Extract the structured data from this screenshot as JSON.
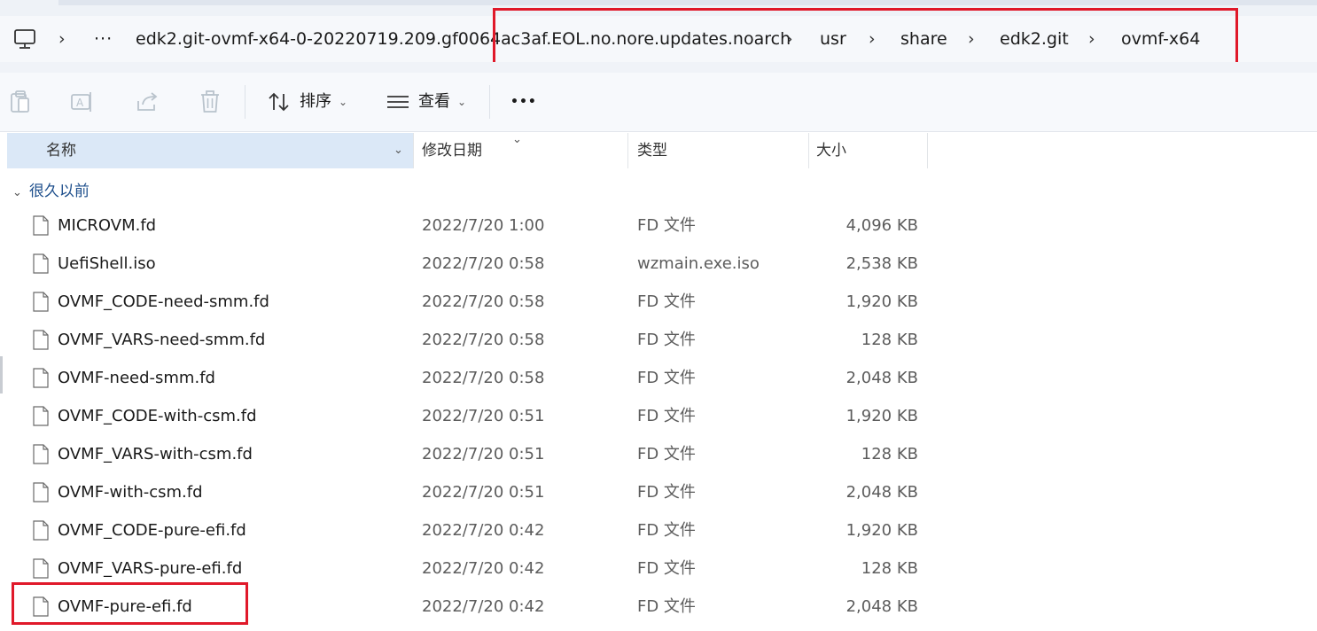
{
  "breadcrumb": {
    "more": "···",
    "segments": [
      "edk2.git-ovmf-x64-0-20220719.209.gf0064ac3af.EOL.no.nore.updates.noarch",
      "usr",
      "share",
      "edk2.git",
      "ovmf-x64"
    ]
  },
  "toolbar": {
    "sort_label": "排序",
    "view_label": "查看",
    "more_label": "•••"
  },
  "columns": {
    "name": "名称",
    "date": "修改日期",
    "type": "类型",
    "size": "大小"
  },
  "group": {
    "label": "很久以前"
  },
  "files": [
    {
      "name": "MICROVM.fd",
      "date": "2022/7/20 1:00",
      "type": "FD 文件",
      "size": "4,096 KB"
    },
    {
      "name": "UefiShell.iso",
      "date": "2022/7/20 0:58",
      "type": "wzmain.exe.iso",
      "size": "2,538 KB"
    },
    {
      "name": "OVMF_CODE-need-smm.fd",
      "date": "2022/7/20 0:58",
      "type": "FD 文件",
      "size": "1,920 KB"
    },
    {
      "name": "OVMF_VARS-need-smm.fd",
      "date": "2022/7/20 0:58",
      "type": "FD 文件",
      "size": "128 KB"
    },
    {
      "name": "OVMF-need-smm.fd",
      "date": "2022/7/20 0:58",
      "type": "FD 文件",
      "size": "2,048 KB"
    },
    {
      "name": "OVMF_CODE-with-csm.fd",
      "date": "2022/7/20 0:51",
      "type": "FD 文件",
      "size": "1,920 KB"
    },
    {
      "name": "OVMF_VARS-with-csm.fd",
      "date": "2022/7/20 0:51",
      "type": "FD 文件",
      "size": "128 KB"
    },
    {
      "name": "OVMF-with-csm.fd",
      "date": "2022/7/20 0:51",
      "type": "FD 文件",
      "size": "2,048 KB"
    },
    {
      "name": "OVMF_CODE-pure-efi.fd",
      "date": "2022/7/20 0:42",
      "type": "FD 文件",
      "size": "1,920 KB"
    },
    {
      "name": "OVMF_VARS-pure-efi.fd",
      "date": "2022/7/20 0:42",
      "type": "FD 文件",
      "size": "128 KB"
    },
    {
      "name": "OVMF-pure-efi.fd",
      "date": "2022/7/20 0:42",
      "type": "FD 文件",
      "size": "2,048 KB"
    }
  ],
  "colors": {
    "highlight": "#e0192a",
    "header_selected": "#dbe8f7",
    "group_text": "#1e4f8c"
  }
}
